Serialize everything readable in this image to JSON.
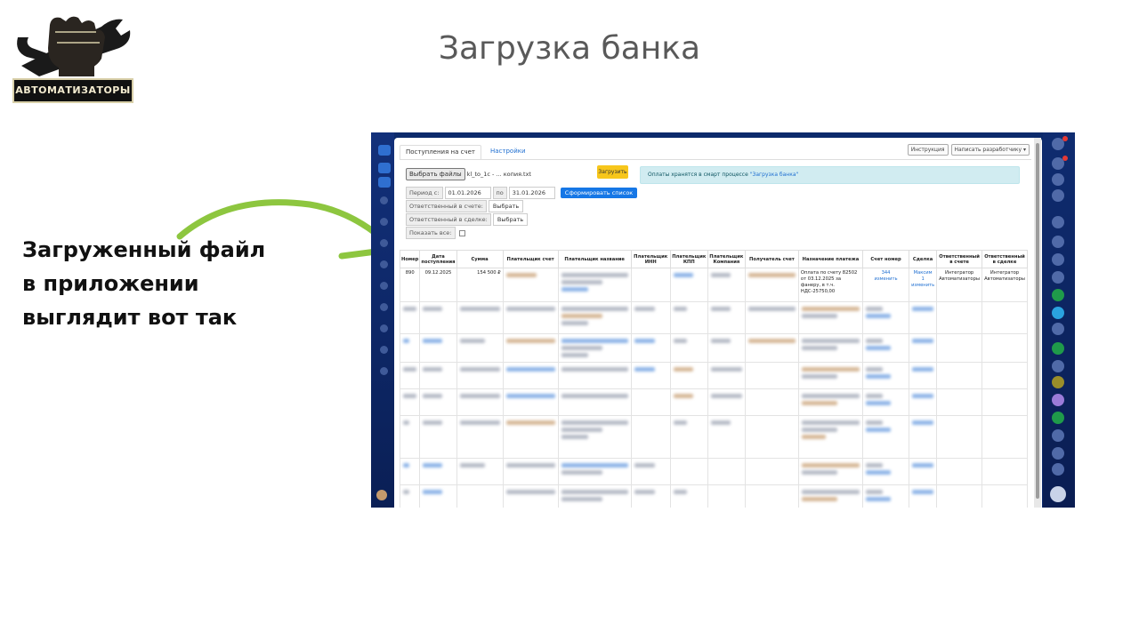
{
  "slide": {
    "title": "Загрузка банка",
    "caption": "Загруженный файл в приложении выглядит вот так",
    "logo_text": "АВТОМАТИЗАТОРЫ"
  },
  "app": {
    "tabs": [
      {
        "label": "Поступления на счет",
        "active": true
      },
      {
        "label": "Настройки",
        "active": false
      }
    ],
    "top_buttons": [
      "Инструкция",
      "Написать разработчику ▾"
    ],
    "file": {
      "button": "Выбрать файлы",
      "name": "kl_to_1c - ... копия.txt"
    },
    "upload_button": "Загрузить",
    "info": {
      "text": "Оплаты хранятся в смарт процессе ",
      "link": "\"Загрузка банка\""
    },
    "period": {
      "label_from": "Период с:",
      "from": "01.01.2026",
      "label_to": "по",
      "to": "31.01.2026",
      "button": "Сформировать список"
    },
    "resp_invoice": {
      "label": "Ответственный в счете:",
      "value": "Выбрать"
    },
    "resp_deal": {
      "label": "Ответственный в сделке:",
      "value": "Выбрать"
    },
    "show_all": {
      "label": "Показать все:"
    },
    "table": {
      "headers": [
        "Номер",
        "Дата поступления",
        "Сумма",
        "Плательщик счет",
        "Плательщик название",
        "Плательщик ИНН",
        "Плательщик КПП",
        "Плательщик Компания",
        "Получатель счет",
        "Назначение платежа",
        "Счет номер",
        "Сделка",
        "Ответственный в счете",
        "Ответственный в сделке"
      ],
      "first_row": {
        "number": "890",
        "date": "09.12.2025",
        "sum": "154 500 ₽",
        "purpose": "Оплата по счету 82502 от 03.12.2025 за фанеру, в т.ч. НДС-25750,00",
        "invoice_no": "344",
        "invoice_action": "изменить",
        "deal": "Максим",
        "deal_no": "1",
        "deal_action": "изменить",
        "resp_invoice": "Интегратор Автоматизаторы",
        "resp_deal": "Интегратор Автоматизаторы"
      }
    }
  },
  "colors": {
    "accent_green": "#8dc63f",
    "portal_blue": "#0c2a6b",
    "upload_yellow": "#f7c61b",
    "primary_blue": "#1677e6"
  },
  "icons": {
    "arrow": "curved-arrow-icon"
  }
}
